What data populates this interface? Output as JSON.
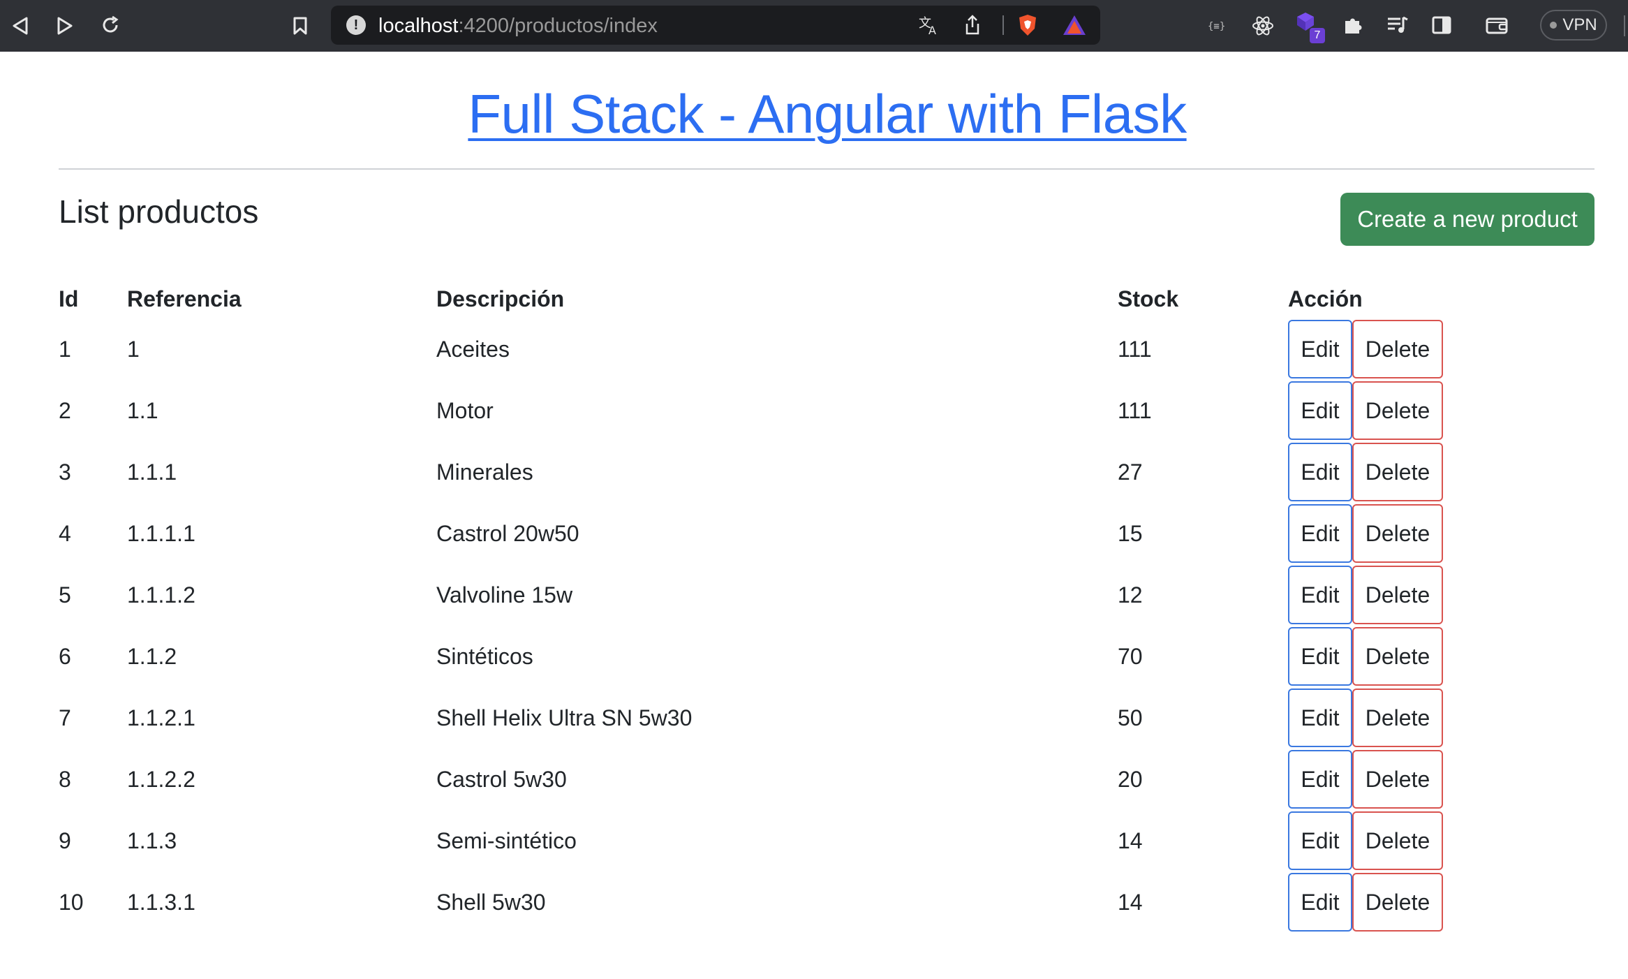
{
  "browser": {
    "url_host": "localhost",
    "url_path": ":4200/productos/index",
    "vpn_label": "VPN",
    "extension_badge": "7"
  },
  "page": {
    "title": "Full Stack - Angular with Flask",
    "list_title": "List productos",
    "create_button": "Create a new product"
  },
  "table": {
    "headers": [
      "Id",
      "Referencia",
      "Descripción",
      "Stock",
      "Acción"
    ],
    "edit_label": "Edit",
    "delete_label": "Delete",
    "rows": [
      {
        "id": "1",
        "ref": "1",
        "desc": "Aceites",
        "stock": "111"
      },
      {
        "id": "2",
        "ref": "1.1",
        "desc": "Motor",
        "stock": "111"
      },
      {
        "id": "3",
        "ref": "1.1.1",
        "desc": "Minerales",
        "stock": "27"
      },
      {
        "id": "4",
        "ref": "1.1.1.1",
        "desc": "Castrol 20w50",
        "stock": "15"
      },
      {
        "id": "5",
        "ref": "1.1.1.2",
        "desc": "Valvoline 15w",
        "stock": "12"
      },
      {
        "id": "6",
        "ref": "1.1.2",
        "desc": "Sintéticos",
        "stock": "70"
      },
      {
        "id": "7",
        "ref": "1.1.2.1",
        "desc": "Shell Helix Ultra SN 5w30",
        "stock": "50"
      },
      {
        "id": "8",
        "ref": "1.1.2.2",
        "desc": "Castrol 5w30",
        "stock": "20"
      },
      {
        "id": "9",
        "ref": "1.1.3",
        "desc": "Semi-sintético",
        "stock": "14"
      },
      {
        "id": "10",
        "ref": "1.1.3.1",
        "desc": "Shell 5w30",
        "stock": "14"
      }
    ]
  },
  "colors": {
    "title_link": "#2c6ef2",
    "create_button": "#3d8b57",
    "edit_border": "#3a78e0",
    "delete_border": "#d9534f"
  }
}
